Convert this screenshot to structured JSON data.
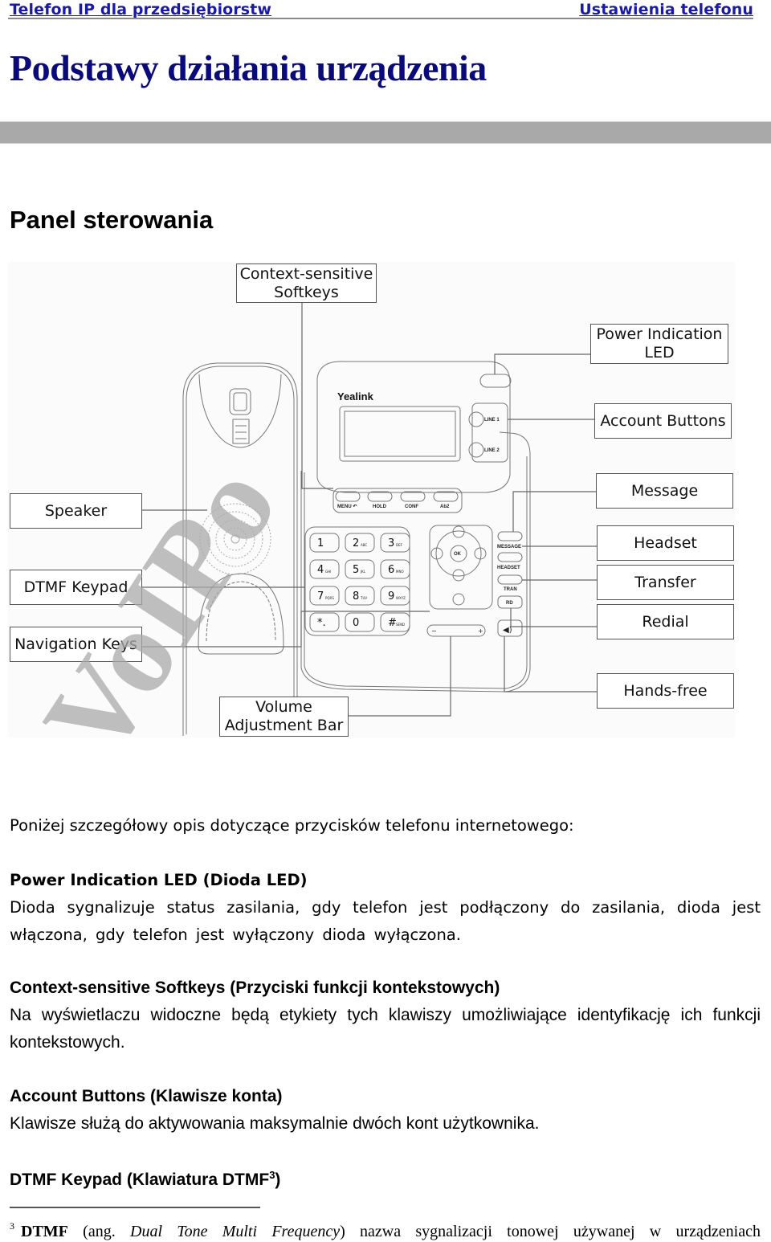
{
  "header": {
    "left_title": "Telefon IP dla przedsiębiorstw",
    "right_title": "Ustawienia telefonu",
    "title_color": "#1a1aa8"
  },
  "main_title": "Podstawy działania urządzenia",
  "section_title": "Panel sterowania",
  "diagram": {
    "brand": "Yealink",
    "callouts": {
      "softkeys": [
        "Context-sensitive",
        "Softkeys"
      ],
      "power_led": [
        "Power Indication",
        "LED"
      ],
      "account_buttons": "Account Buttons",
      "speaker": "Speaker",
      "message": "Message",
      "dtmf_keypad": "DTMF Keypad",
      "headset": "Headset",
      "transfer": "Transfer",
      "navigation_keys": "Navigation Keys",
      "redial": "Redial",
      "hands_free": "Hands-free",
      "volume": [
        "Volume",
        "Adjustment Bar"
      ]
    },
    "softkey_labels": [
      "MENU ↶",
      "HOLD",
      "CONF",
      "Ab2"
    ],
    "line_labels": [
      "LINE 1",
      "LINE 2"
    ],
    "keypad": [
      {
        "digit": "1",
        "sub": ""
      },
      {
        "digit": "2",
        "sub": "ABC"
      },
      {
        "digit": "3",
        "sub": "DEF"
      },
      {
        "digit": "4",
        "sub": "GHI"
      },
      {
        "digit": "5",
        "sub": "JKL"
      },
      {
        "digit": "6",
        "sub": "MNO"
      },
      {
        "digit": "7",
        "sub": "PQRS"
      },
      {
        "digit": "8",
        "sub": "TUV"
      },
      {
        "digit": "9",
        "sub": "WXYZ"
      },
      {
        "digit": "*.",
        "sub": ""
      },
      {
        "digit": "0",
        "sub": ""
      },
      {
        "digit": "#",
        "sub": "SEND"
      }
    ],
    "nav_ok": "OK",
    "func_labels": [
      "MESSAGE",
      "HEADSET",
      "TRAN",
      "RD"
    ]
  },
  "intro": "Poniżej szczegółowy opis dotyczące przycisków telefonu internetowego:",
  "sections": [
    {
      "heading": "Power Indication LED (Dioda LED)",
      "text": "Dioda sygnalizuje status zasilania, gdy telefon jest podłączony do zasilania, dioda jest włączona, gdy telefon jest wyłączony dioda wyłączona."
    },
    {
      "heading": "Context-sensitive Softkeys (Przyciski funkcji kontekstowych)",
      "text": "Na wyświetlaczu widoczne będą etykiety tych klawiszy umożliwiające identyfikację ich funkcji kontekstowych."
    },
    {
      "heading": "Account Buttons (Klawisze konta)",
      "text": "Klawisze służą do aktywowania maksymalnie dwóch kont użytkownika."
    },
    {
      "heading": "DTMF Keypad (Klawiatura DTMF",
      "heading_sup": "3",
      "heading_end": ")"
    }
  ],
  "footnote": {
    "number": "3",
    "term": "DTMF",
    "pre": "(ang.",
    "italic": "Dual Tone Multi Frequency",
    "post": ") nazwa sygnalizacji tonowej używanej w urządzeniach"
  },
  "watermark": "VoIPo"
}
